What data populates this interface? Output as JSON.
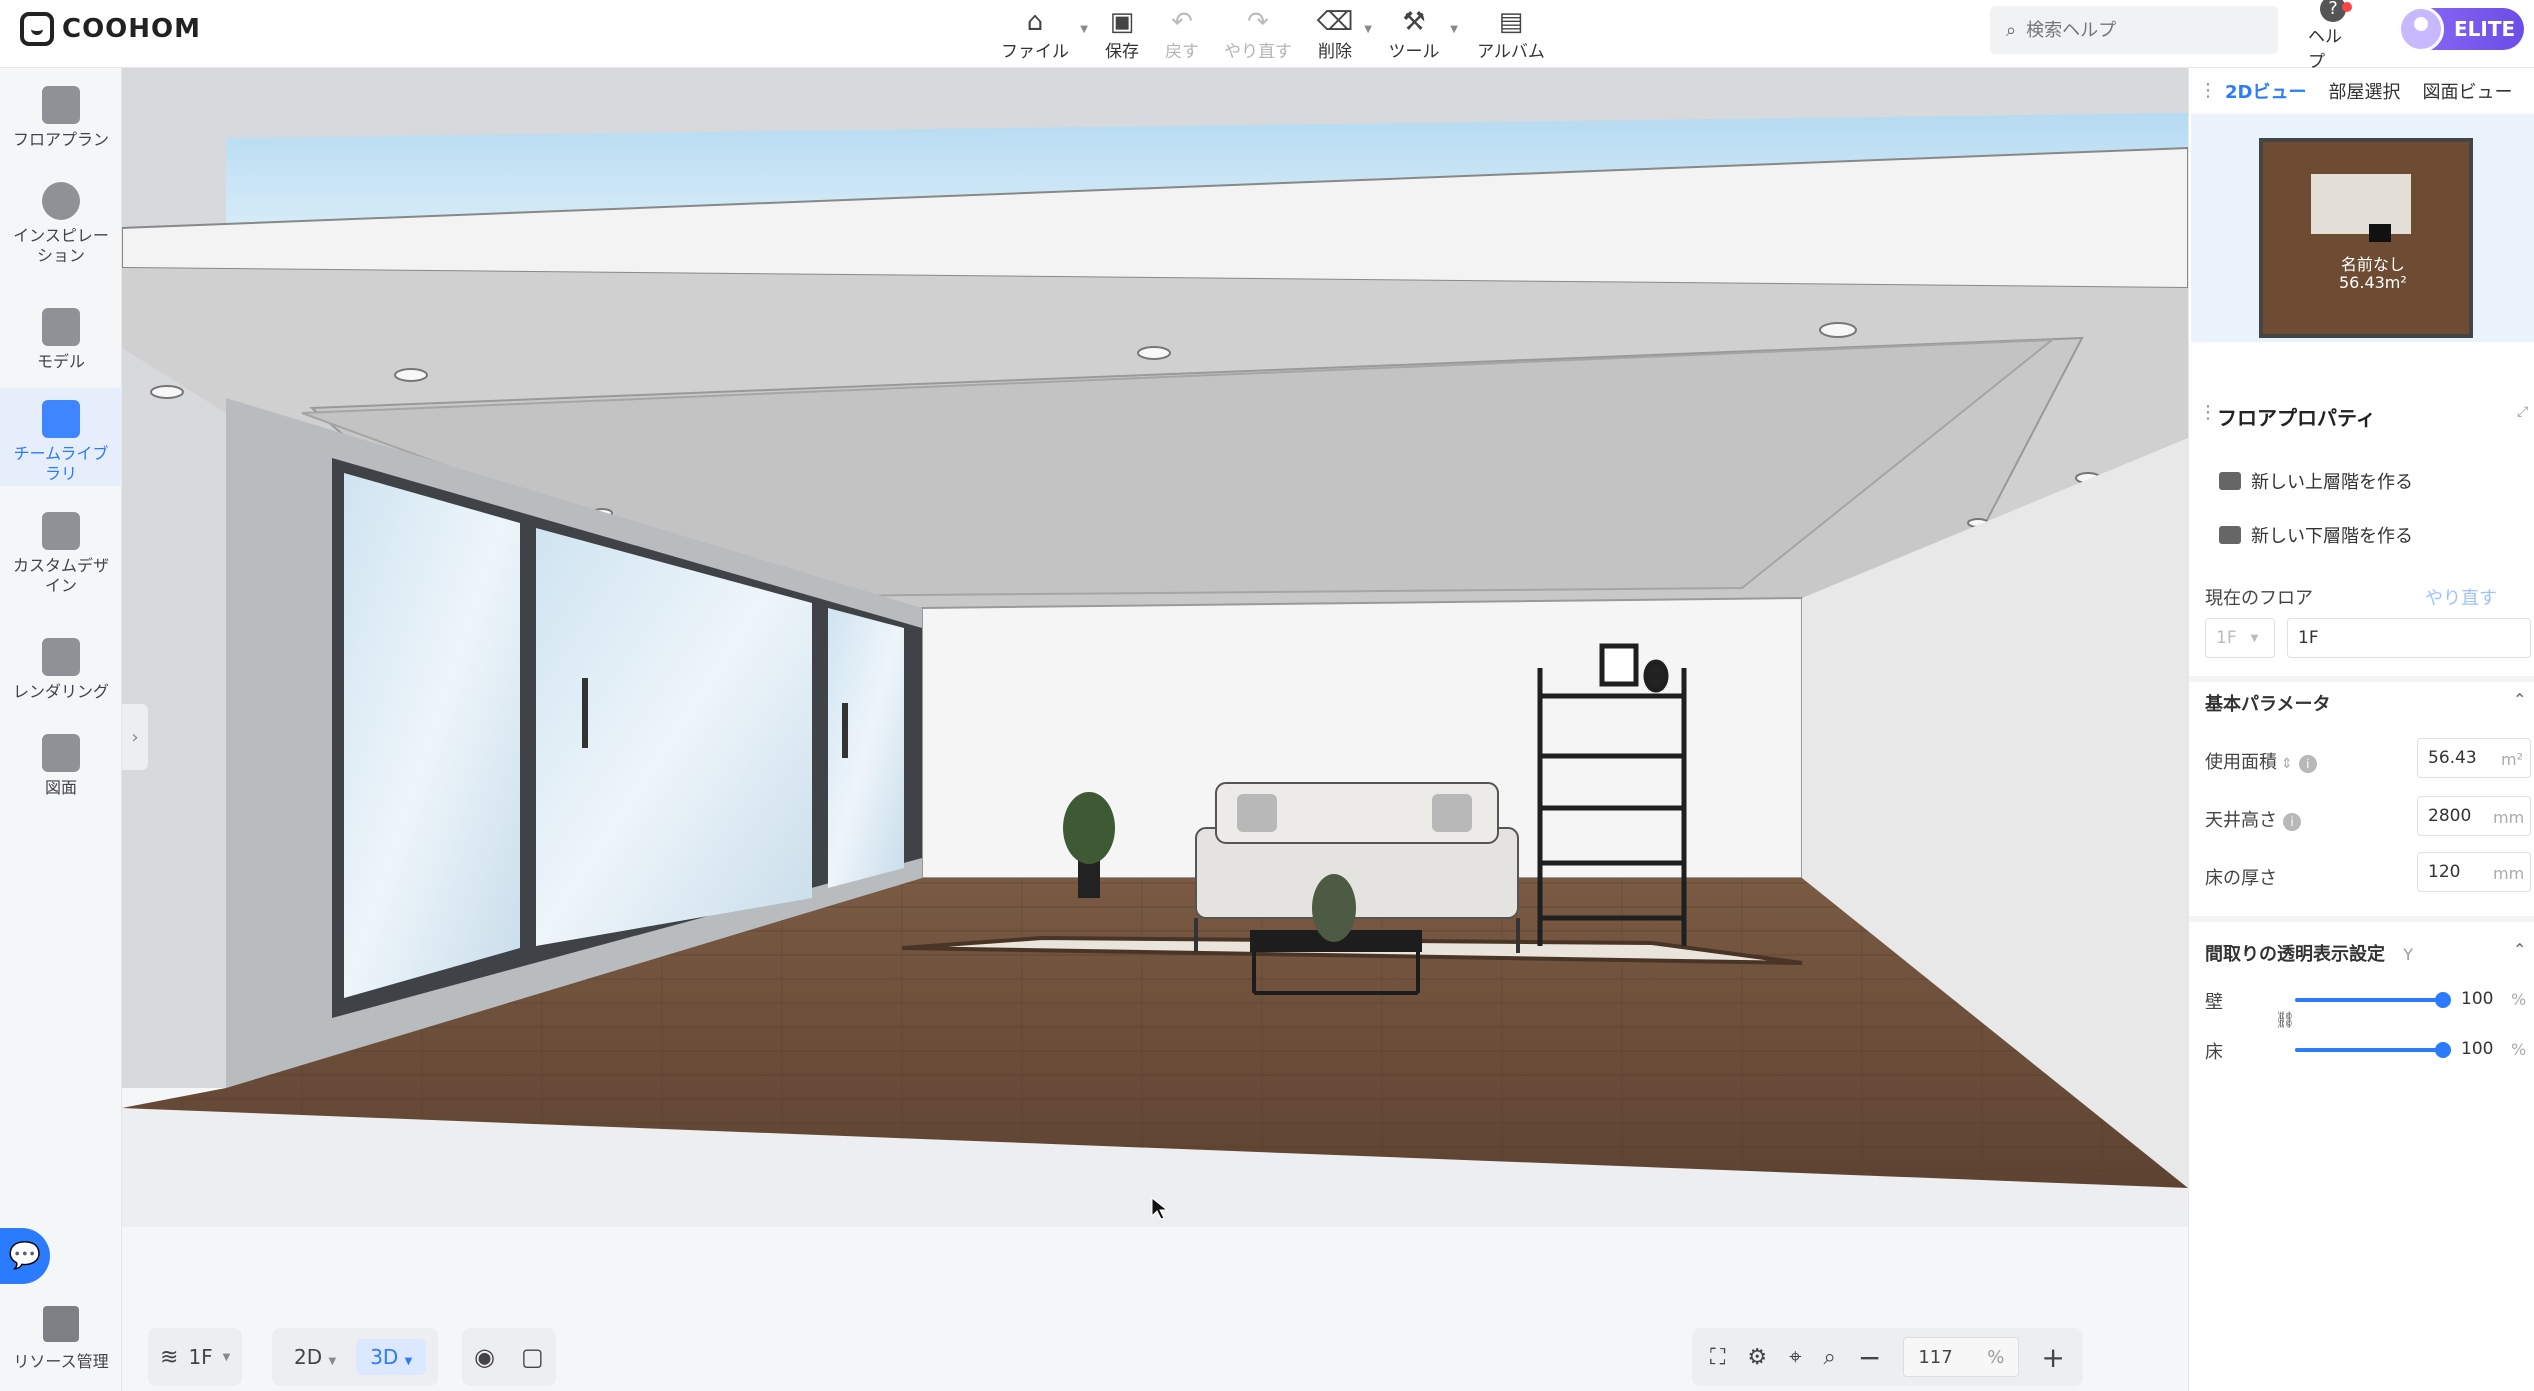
{
  "app": {
    "logo_text": "COOHOM"
  },
  "toolbar": {
    "file": "ファイル",
    "save": "保存",
    "undo": "戻す",
    "redo": "やり直す",
    "delete": "削除",
    "tools": "ツール",
    "album": "アルバム"
  },
  "search": {
    "placeholder": "検索ヘルプ"
  },
  "help_label": "ヘルプ",
  "account_badge": "ELITE",
  "sidebar": {
    "items": [
      {
        "label": "フロアプラン",
        "icon": "floor-plan-icon"
      },
      {
        "label": "インスピレーション",
        "icon": "lightbulb-icon"
      },
      {
        "label": "モデル",
        "icon": "sofa-icon"
      },
      {
        "label": "チームライブラリ",
        "icon": "crown-icon",
        "active": true
      },
      {
        "label": "カスタムデザイン",
        "icon": "custom-design-icon"
      },
      {
        "label": "レンダリング",
        "icon": "camera-icon"
      },
      {
        "label": "図面",
        "icon": "drawing-icon"
      }
    ],
    "resource": "リソース管理"
  },
  "right_panel": {
    "tabs": [
      "2Dビュー",
      "部屋選択",
      "図面ビュー"
    ],
    "minimap": {
      "room_name": "名前なし",
      "room_area": "56.43m²"
    },
    "title": "フロアプロパティ",
    "new_upper": "新しい上層階を作る",
    "new_lower": "新しい下層階を作る",
    "current_floor_label": "現在のフロア",
    "redo_label": "やり直す",
    "floor_select": "1F",
    "floor_name": "1F",
    "basic_params": "基本パラメータ",
    "area_label": "使用面積",
    "area_value": "56.43",
    "area_unit": "m²",
    "ceiling_label": "天井高さ",
    "ceiling_value": "2800",
    "ceiling_unit": "mm",
    "floor_thickness_label": "床の厚さ",
    "floor_thickness_value": "120",
    "floor_thickness_unit": "mm",
    "transparency_title": "間取りの透明表示設定",
    "transparency_hint": "Y",
    "wall_label": "壁",
    "wall_value": "100",
    "wall_unit": "%",
    "floor_label": "床",
    "floor_value": "100",
    "floor_unit": "%"
  },
  "bottom": {
    "floor": "1F",
    "view2d": "2D",
    "view3d": "3D",
    "zoom": "117",
    "zoom_unit": "%"
  },
  "colors": {
    "accent": "#2b7bff",
    "floor_wood": "#6b4e3a",
    "sky": "#bcdcf0"
  }
}
